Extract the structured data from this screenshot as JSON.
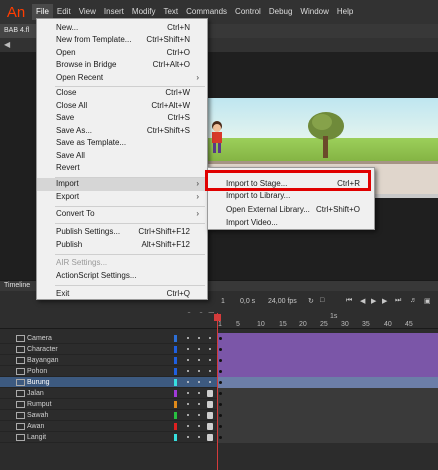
{
  "app": {
    "logo_text": "An",
    "brand_color": "#ff3d00"
  },
  "menubar": {
    "items": [
      "File",
      "Edit",
      "View",
      "Insert",
      "Modify",
      "Text",
      "Commands",
      "Control",
      "Debug",
      "Window",
      "Help"
    ],
    "active": "File"
  },
  "document": {
    "tab_label": "BAB 4.fl"
  },
  "file_menu": {
    "items": [
      {
        "label": "New...",
        "shortcut": "Ctrl+N"
      },
      {
        "label": "New from Template...",
        "shortcut": "Ctrl+Shift+N"
      },
      {
        "label": "Open",
        "shortcut": "Ctrl+O"
      },
      {
        "label": "Browse in Bridge",
        "shortcut": "Ctrl+Alt+O"
      },
      {
        "label": "Open Recent",
        "shortcut": "",
        "submenu": true
      },
      {
        "label": "Close",
        "shortcut": "Ctrl+W"
      },
      {
        "label": "Close All",
        "shortcut": "Ctrl+Alt+W"
      },
      {
        "label": "Save",
        "shortcut": "Ctrl+S"
      },
      {
        "label": "Save As...",
        "shortcut": "Ctrl+Shift+S"
      },
      {
        "label": "Save as Template...",
        "shortcut": ""
      },
      {
        "label": "Save All",
        "shortcut": ""
      },
      {
        "label": "Revert",
        "shortcut": ""
      },
      {
        "label": "Import",
        "shortcut": "",
        "submenu": true,
        "highlighted": true
      },
      {
        "label": "Export",
        "shortcut": "",
        "submenu": true
      },
      {
        "label": "Convert To",
        "shortcut": "",
        "submenu": true
      },
      {
        "label": "Publish Settings...",
        "shortcut": "Ctrl+Shift+F12"
      },
      {
        "label": "Publish",
        "shortcut": "Alt+Shift+F12"
      },
      {
        "label": "AIR Settings...",
        "shortcut": "",
        "disabled": true
      },
      {
        "label": "ActionScript Settings...",
        "shortcut": ""
      },
      {
        "label": "Exit",
        "shortcut": "Ctrl+Q"
      }
    ]
  },
  "import_submenu": {
    "items": [
      {
        "label": "Import to Stage...",
        "shortcut": "Ctrl+R"
      },
      {
        "label": "Import to Library...",
        "shortcut": ""
      },
      {
        "label": "Open External Library...",
        "shortcut": "Ctrl+Shift+O"
      },
      {
        "label": "Import Video...",
        "shortcut": ""
      }
    ],
    "highlight_color": "#e00000"
  },
  "timeline": {
    "title": "Timeline",
    "current_frame": "1",
    "time": "0,0 s",
    "fps": "24,00 fps",
    "ruler_seconds_label": "1s",
    "ruler_ticks": [
      "1",
      "5",
      "10",
      "15",
      "20",
      "25",
      "30",
      "35",
      "40",
      "45"
    ],
    "layers": [
      {
        "name": "Camera",
        "color": "#2d6fd6",
        "lock": false,
        "frames": "purple"
      },
      {
        "name": "Character",
        "color": "#1f5fe0",
        "lock": false,
        "frames": "purple"
      },
      {
        "name": "Bayangan",
        "color": "#1f5fe0",
        "lock": false,
        "frames": "purple"
      },
      {
        "name": "Pohon",
        "color": "#1f5fe0",
        "lock": false,
        "frames": "purple"
      },
      {
        "name": "Burung",
        "color": "#37e0e0",
        "lock": false,
        "frames": "sel",
        "selected": true
      },
      {
        "name": "Jalan",
        "color": "#a03ad8",
        "lock": true,
        "frames": "grey"
      },
      {
        "name": "Rumput",
        "color": "#e08a1a",
        "lock": true,
        "frames": "grey"
      },
      {
        "name": "Sawah",
        "color": "#28c040",
        "lock": true,
        "frames": "grey"
      },
      {
        "name": "Awan",
        "color": "#e02020",
        "lock": true,
        "frames": "grey"
      },
      {
        "name": "Langit",
        "color": "#37e0e0",
        "lock": true,
        "frames": "grey"
      }
    ]
  }
}
